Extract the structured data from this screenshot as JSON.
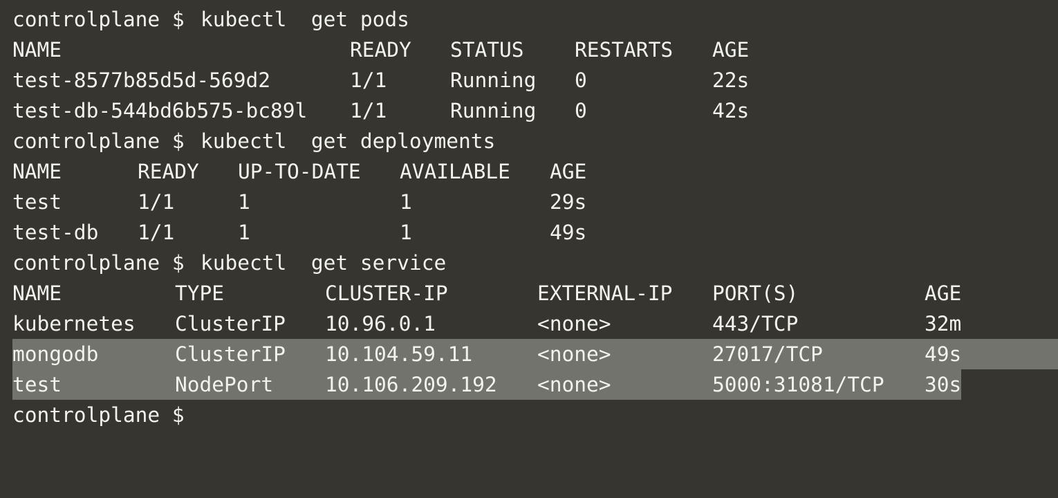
{
  "colors": {
    "background": "#363530",
    "foreground": "#f2f2ee",
    "selection": "#72736d"
  },
  "prompt": "controlplane $",
  "commands": [
    "kubectl  get pods",
    "kubectl  get deployments",
    "kubectl  get service"
  ],
  "pods": {
    "headers": [
      "NAME",
      "READY",
      "STATUS",
      "RESTARTS",
      "AGE"
    ],
    "rows": [
      [
        "test-8577b85d5d-569d2",
        "1/1",
        "Running",
        "0",
        "22s"
      ],
      [
        "test-db-544bd6b575-bc89l",
        "1/1",
        "Running",
        "0",
        "42s"
      ]
    ]
  },
  "deployments": {
    "headers": [
      "NAME",
      "READY",
      "UP-TO-DATE",
      "AVAILABLE",
      "AGE"
    ],
    "rows": [
      [
        "test",
        "1/1",
        "1",
        "1",
        "29s"
      ],
      [
        "test-db",
        "1/1",
        "1",
        "1",
        "49s"
      ]
    ]
  },
  "services": {
    "headers": [
      "NAME",
      "TYPE",
      "CLUSTER-IP",
      "EXTERNAL-IP",
      "PORT(S)",
      "AGE"
    ],
    "rows": [
      [
        "kubernetes",
        "ClusterIP",
        "10.96.0.1",
        "<none>",
        "443/TCP",
        "32m"
      ],
      [
        "mongodb",
        "ClusterIP",
        "10.104.59.11",
        "<none>",
        "27017/TCP",
        "49s"
      ],
      [
        "test",
        "NodePort",
        "10.106.209.192",
        "<none>",
        "5000:31081/TCP",
        "30s"
      ]
    ]
  }
}
